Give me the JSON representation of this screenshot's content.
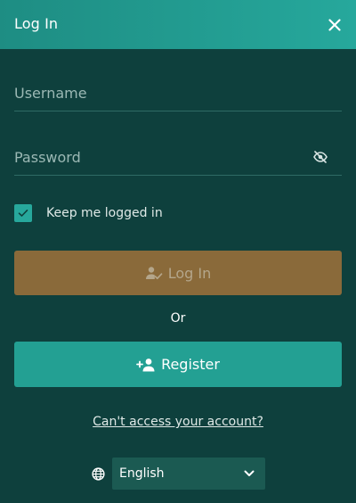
{
  "dialog": {
    "title": "Log In",
    "close_icon": "close-icon"
  },
  "form": {
    "username": {
      "value": "",
      "placeholder": "Username"
    },
    "password": {
      "value": "",
      "placeholder": "Password",
      "toggle_icon": "eye-off-icon"
    },
    "keep_logged_in": {
      "label": "Keep me logged in",
      "checked": true
    }
  },
  "buttons": {
    "login": {
      "label": "Log In",
      "icon": "user-check-icon"
    },
    "or_text": "Or",
    "register": {
      "label": "Register",
      "icon": "user-add-icon"
    }
  },
  "help": {
    "cant_access": "Can't access your account?"
  },
  "language": {
    "selected": "English",
    "icon": "globe-icon"
  },
  "colors": {
    "background": "#0e403d",
    "header": "#26a89c",
    "accent": "#27a89c",
    "login_button": "#8a6a3a",
    "register_button": "#23a093"
  }
}
